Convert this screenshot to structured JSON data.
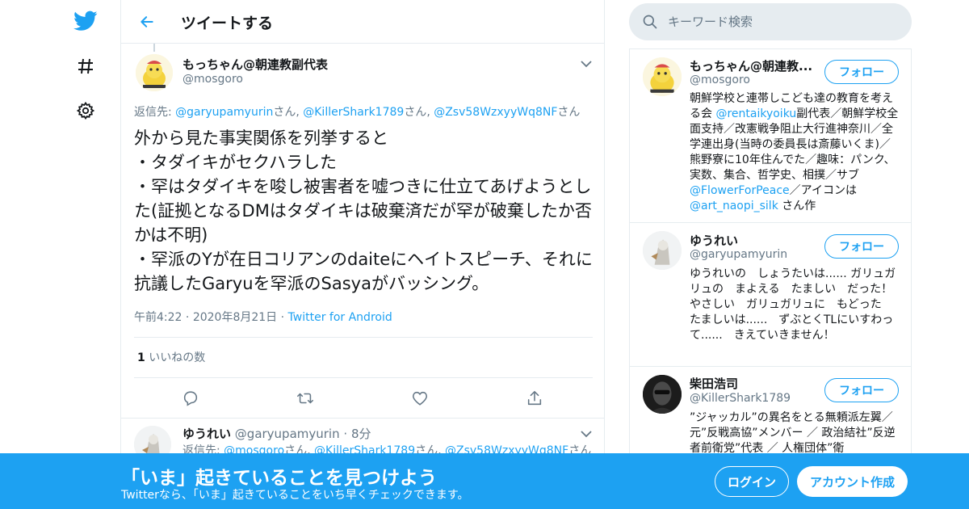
{
  "colors": {
    "accent": "#1da1f2",
    "text": "#14171a",
    "muted": "#657786",
    "border": "#e6ecf0"
  },
  "nav": {
    "icons": [
      "twitter-bird-icon",
      "hashtag-icon",
      "gear-icon"
    ]
  },
  "header": {
    "title": "ツイートする"
  },
  "tweet": {
    "name": "もっちゃん@朝連教副代表",
    "handle": "@mosgoro",
    "reply_prefix": "返信先: ",
    "reply_users": [
      "@garyupamyurin",
      "@KillerShark1789",
      "@Zsv58WzxyyWq8NF"
    ],
    "reply_suffix": "さん",
    "body": "外から見た事実関係を列挙すると\n・タダイキがセクハラした\n・罕はタダイキを唆し被害者を嘘つきに仕立てあげようとした(証拠となるDMはタダイキは破棄済だが罕が破棄したか否かは不明)\n・罕派のYが在日コリアンのdaiteにヘイトスピーチ、それに抗議したGaryuを罕派のSasyaがバッシング。",
    "time": "午前4:22",
    "date": "2020年8月21日",
    "source": "Twitter for Android",
    "like_count": "1",
    "like_label": "いいねの数"
  },
  "reply": {
    "name": "ゆうれい",
    "handle": "@garyupamyurin",
    "age": "8分",
    "reply_prefix": "返信先: ",
    "reply_users": [
      "@mosgoro",
      "@KillerShark1789",
      "@Zsv58WzxyyWq8NF"
    ],
    "reply_suffix": "さん"
  },
  "search": {
    "placeholder": "キーワード検索"
  },
  "cards": [
    {
      "name": "もっちゃん@朝連教...",
      "handle": "@mosgoro",
      "follow": "フォロー",
      "bio_1": "朝鮮学校と連帯しこども達の教育を考える会 ",
      "bio_link_1": "@rentaikyoiku",
      "bio_2": "副代表／朝鮮学校全面支持／改憲戦争阻止大行進神奈川／全学連出身(当時の委員長は斎藤いくま)／熊野寮に10年住んでた／趣味：パンク、実数、集合、哲学史、相撲／サブ",
      "bio_link_2": "@FlowerForPeace",
      "bio_3": "／アイコンは ",
      "bio_link_3": "@art_naopi_silk",
      "bio_4": " さん作"
    },
    {
      "name": "ゆうれい",
      "handle": "@garyupamyurin",
      "follow": "フォロー",
      "bio": "ゆうれいの　しょうたいは...... ガリュガリュの　まよえる　たましい　だった！ やさしい　ガリュガリュに　もどった　たましいは......　ずぶとくTLにいすわって......　きえていきません！"
    },
    {
      "name": "柴田浩司",
      "handle": "@KillerShark1789",
      "follow": "フォロー",
      "bio": "”ジャッカル”の異名をとる無頼派左翼／ 元”反戦高協”メンバー ／ 政治結社”反逆者前衛党”代表 ／ 人権団体”衛"
    }
  ],
  "banner": {
    "title": "「いま」起きていることを見つけよう",
    "subtitle": "Twitterなら、「いま」起きていることをいち早くチェックできます。",
    "login": "ログイン",
    "signup": "アカウント作成"
  }
}
